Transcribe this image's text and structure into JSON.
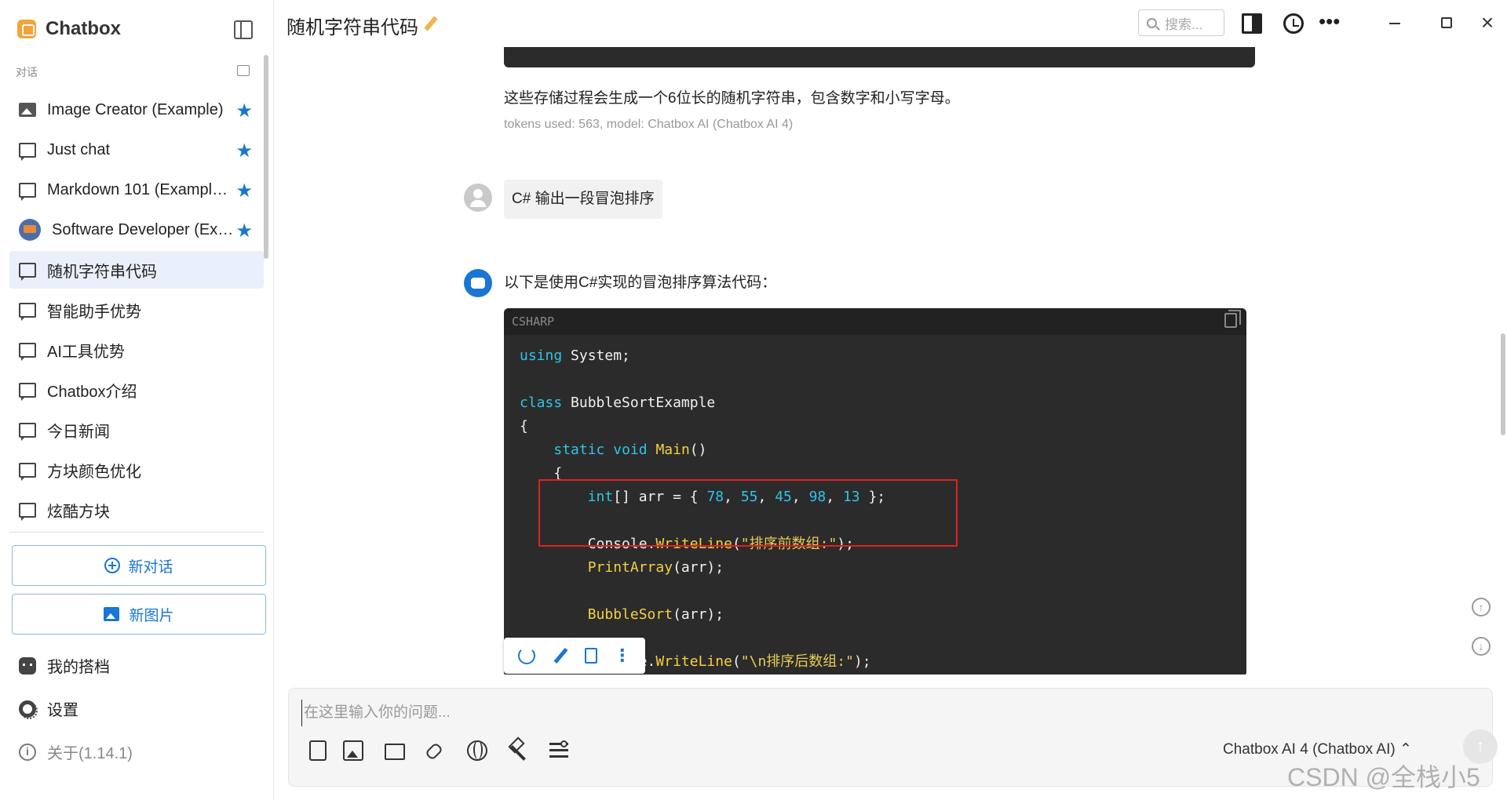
{
  "sidebar": {
    "app_name": "Chatbox",
    "section_label": "对话",
    "conversations": [
      {
        "label": "Image Creator (Example)",
        "icon": "image-icon",
        "starred": true
      },
      {
        "label": "Just chat",
        "icon": "chat-bubble-icon",
        "starred": true
      },
      {
        "label": "Markdown 101 (Exampl…",
        "icon": "chat-bubble-icon",
        "starred": true
      },
      {
        "label": "Software Developer (Ex…",
        "icon": "developer-avatar-icon",
        "starred": true
      },
      {
        "label": "随机字符串代码",
        "icon": "chat-bubble-icon",
        "starred": false,
        "active": true
      },
      {
        "label": "智能助手优势",
        "icon": "chat-bubble-icon",
        "starred": false
      },
      {
        "label": "AI工具优势",
        "icon": "chat-bubble-icon",
        "starred": false
      },
      {
        "label": "Chatbox介绍",
        "icon": "chat-bubble-icon",
        "starred": false
      },
      {
        "label": "今日新闻",
        "icon": "chat-bubble-icon",
        "starred": false
      },
      {
        "label": "方块颜色优化",
        "icon": "chat-bubble-icon",
        "starred": false
      },
      {
        "label": "炫酷方块",
        "icon": "chat-bubble-icon",
        "starred": false
      }
    ],
    "new_chat_label": "新对话",
    "new_image_label": "新图片",
    "my_partners_label": "我的搭档",
    "settings_label": "设置",
    "about_label": "关于(1.14.1)"
  },
  "header": {
    "title": "随机字符串代码",
    "search_placeholder": "搜索..."
  },
  "chat": {
    "prev_reply_text": "这些存储过程会生成一个6位长的随机字符串，包含数字和小写字母。",
    "prev_reply_meta": "tokens used: 563, model: Chatbox AI (Chatbox AI 4)",
    "user_message": "C# 输出一段冒泡排序",
    "bot_intro": "以下是使用C#实现的冒泡排序算法代码：",
    "code_language": "CSHARP",
    "code_lines": [
      "using System;",
      "",
      "class BubbleSortExample",
      "{",
      "    static void Main()",
      "    {",
      "        int[] arr = { 78, 55, 45, 98, 13 };",
      "",
      "        Console.WriteLine(\"排序前数组:\");",
      "        PrintArray(arr);",
      "",
      "        BubbleSort(arr);",
      "",
      "        Console.WriteLine(\"\\n排序后数组:\");"
    ]
  },
  "input": {
    "placeholder": "在这里输入你的问题...",
    "model_label": "Chatbox AI 4 (Chatbox AI) ⌃"
  },
  "watermark": "CSDN @全栈小5",
  "colors": {
    "accent": "#1976d2",
    "code_bg": "#2b2b2b",
    "highlight_box": "#e02020"
  }
}
